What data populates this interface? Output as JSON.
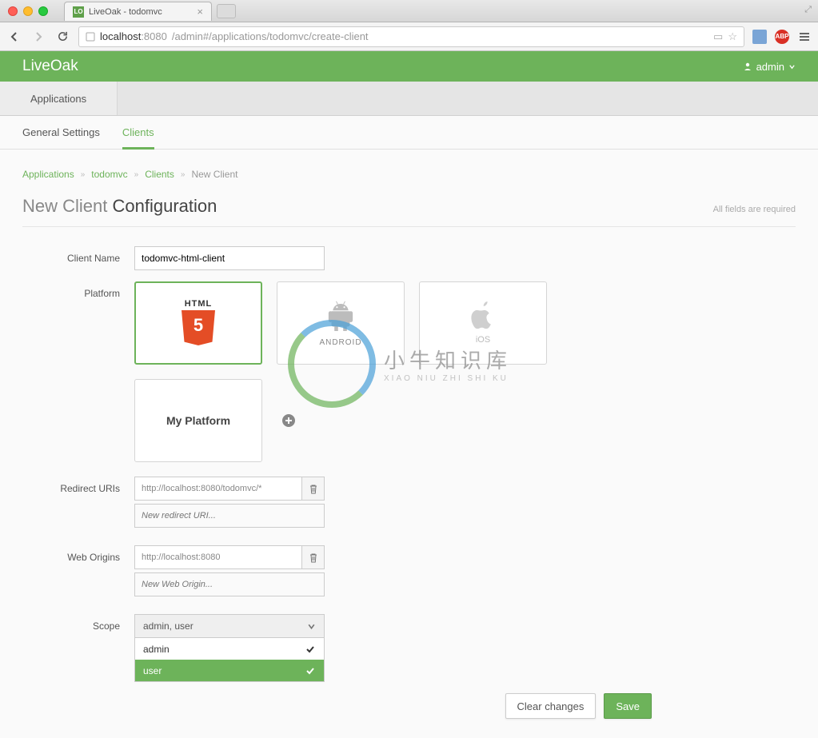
{
  "browser": {
    "tab_title": "LiveOak - todomvc",
    "url_host": "localhost",
    "url_port": ":8080",
    "url_path": "/admin#/applications/todomvc/create-client"
  },
  "header": {
    "brand": "LiveOak",
    "user": "admin"
  },
  "top_tabs": {
    "applications": "Applications"
  },
  "sub_tabs": {
    "general": "General Settings",
    "clients": "Clients"
  },
  "breadcrumb": {
    "a": "Applications",
    "b": "todomvc",
    "c": "Clients",
    "d": "New Client"
  },
  "page": {
    "title_prefix": "New Client ",
    "title_main": "Configuration",
    "required_note": "All fields are required"
  },
  "labels": {
    "client_name": "Client Name",
    "platform": "Platform",
    "redirect_uris": "Redirect URIs",
    "web_origins": "Web Origins",
    "scope": "Scope"
  },
  "form": {
    "client_name_value": "todomvc-html-client",
    "platforms": {
      "html5": "HTML",
      "android": "ANDROID",
      "ios": "iOS",
      "custom": "My Platform"
    },
    "redirect_uri_0": "http://localhost:8080/todomvc/*",
    "redirect_uri_new_placeholder": "New redirect URI...",
    "web_origin_0": "http://localhost:8080",
    "web_origin_new_placeholder": "New Web Origin...",
    "scope_summary": "admin, user",
    "scope_options": {
      "admin": "admin",
      "user": "user"
    }
  },
  "buttons": {
    "clear": "Clear changes",
    "save": "Save"
  },
  "watermark": {
    "big": "小牛知识库",
    "small": "XIAO NIU ZHI SHI KU"
  }
}
